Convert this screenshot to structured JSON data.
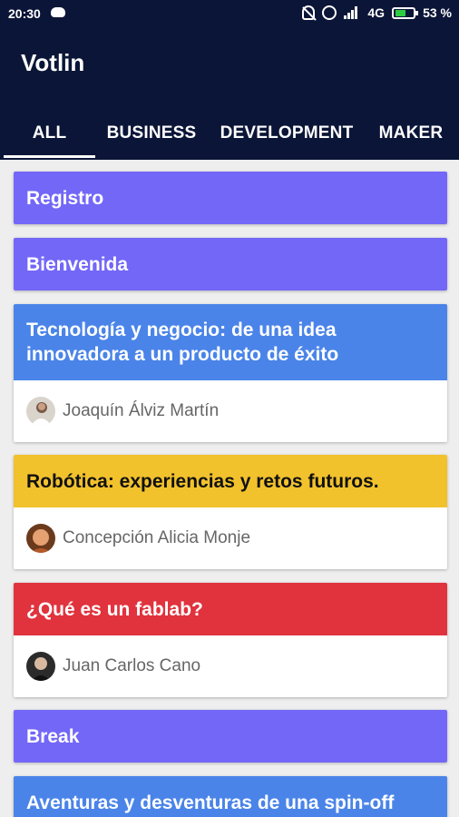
{
  "status_bar": {
    "time": "20:30",
    "network": "4G",
    "battery": "53 %",
    "icons": [
      "cat-icon",
      "bell-off-icon",
      "alarm-icon",
      "signal-icon",
      "battery-icon"
    ]
  },
  "app": {
    "title": "Votlin"
  },
  "tabs": [
    {
      "label": "ALL",
      "active": true
    },
    {
      "label": "BUSINESS",
      "active": false
    },
    {
      "label": "DEVELOPMENT",
      "active": false
    },
    {
      "label": "MAKER",
      "active": false
    }
  ],
  "colors": {
    "header": "#0b1537",
    "purple": "#7367f8",
    "blue": "#4a84e9",
    "yellow": "#f2c22d",
    "red": "#e0333d"
  },
  "talks": [
    {
      "title": "Registro"
    },
    {
      "title": "Bienvenida"
    },
    {
      "title": "Tecnología y negocio: de una idea innovadora a un producto de éxito",
      "speaker": "Joaquín Álviz Martín"
    },
    {
      "title": "Robótica: experiencias y retos futuros.",
      "speaker": "Concepción Alicia Monje"
    },
    {
      "title": "¿Qué es un fablab?",
      "speaker": "Juan Carlos Cano"
    },
    {
      "title": "Break"
    },
    {
      "title": "Aventuras y desventuras de una spin-off"
    }
  ]
}
